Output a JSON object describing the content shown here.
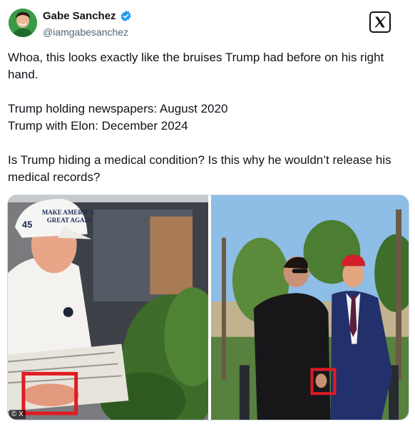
{
  "author": {
    "name": "Gabe Sanchez",
    "handle": "@iamgabesanchez",
    "verified_icon": "verified-badge-icon",
    "avatar_color": "#2f8a3c"
  },
  "platform_logo": "x-logo-icon",
  "tweet": {
    "lines": [
      "Whoa, this looks exactly like the bruises Trump had before on his right hand.",
      "Trump holding newspapers: August 2020",
      "Trump with Elon: December 2024",
      "Is Trump hiding a medical condition? Is this why he wouldn’t release his medical records?"
    ]
  },
  "photos": {
    "left": {
      "hat_text_line1": "MAKE AMERICA",
      "hat_text_line2": "GREAT AGAIN",
      "hat_number": "45"
    },
    "highlight_color": "#e11b22"
  },
  "watermark": "© X"
}
